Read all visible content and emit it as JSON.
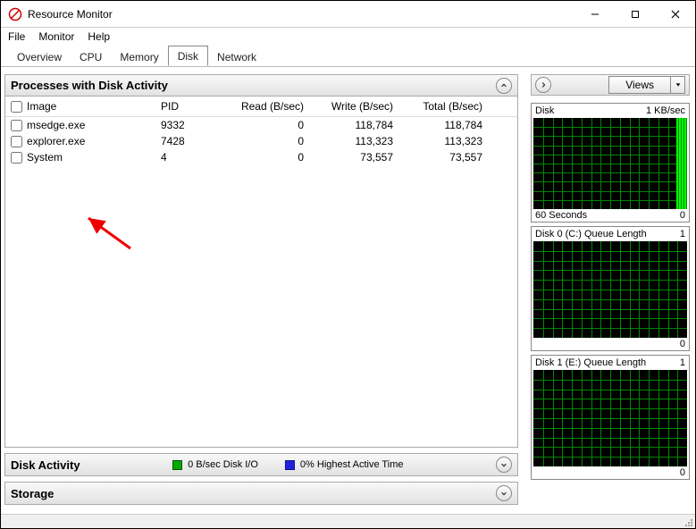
{
  "window": {
    "title": "Resource Monitor"
  },
  "menu": {
    "file": "File",
    "monitor": "Monitor",
    "help": "Help"
  },
  "tabs": {
    "overview": "Overview",
    "cpu": "CPU",
    "memory": "Memory",
    "disk": "Disk",
    "network": "Network",
    "active": "disk"
  },
  "processes_panel": {
    "title": "Processes with Disk Activity",
    "columns": {
      "image": "Image",
      "pid": "PID",
      "read": "Read (B/sec)",
      "write": "Write (B/sec)",
      "total": "Total (B/sec)"
    },
    "rows": [
      {
        "image": "msedge.exe",
        "pid": "9332",
        "read": "0",
        "write": "118,784",
        "total": "118,784"
      },
      {
        "image": "explorer.exe",
        "pid": "7428",
        "read": "0",
        "write": "113,323",
        "total": "113,323"
      },
      {
        "image": "System",
        "pid": "4",
        "read": "0",
        "write": "73,557",
        "total": "73,557"
      }
    ]
  },
  "disk_activity_panel": {
    "title": "Disk Activity",
    "io": "0 B/sec Disk I/O",
    "active_time": "0% Highest Active Time"
  },
  "storage_panel": {
    "title": "Storage"
  },
  "sidebar": {
    "views_label": "Views",
    "graphs": [
      {
        "title": "Disk",
        "top_right": "1 KB/sec",
        "foot_left": "60 Seconds",
        "foot_right": "0",
        "has_bars": true
      },
      {
        "title": "Disk 0 (C:) Queue Length",
        "top_right": "1",
        "foot_left": "",
        "foot_right": "0",
        "has_bars": false
      },
      {
        "title": "Disk 1 (E:) Queue Length",
        "top_right": "1",
        "foot_left": "",
        "foot_right": "0",
        "has_bars": false
      }
    ]
  }
}
